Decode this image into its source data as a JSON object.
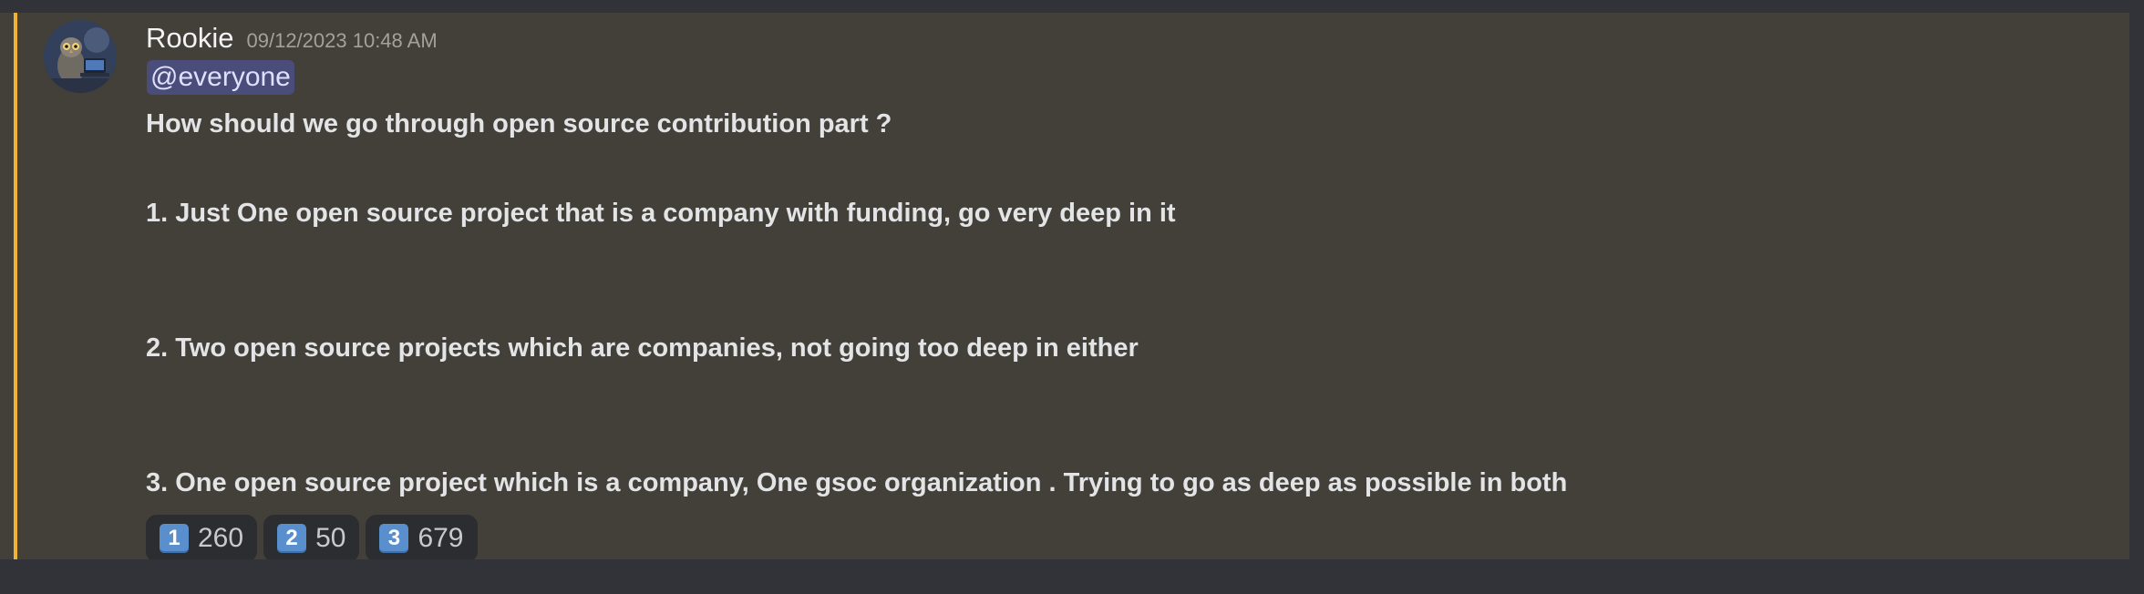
{
  "message": {
    "author": "Rookie",
    "timestamp": "09/12/2023 10:48 AM",
    "mention": "@everyone",
    "lines": [
      "How should we go through open source contribution part ?",
      "1. Just One open source project that is a company with funding, go very deep in it",
      "2. Two open source projects which are companies, not going too deep in either",
      "3. One open source project which is a company, One gsoc organization . Trying to go as deep as possible in both"
    ],
    "reactions": [
      {
        "emoji": "1",
        "icon": "keycap-1-icon",
        "count": "260"
      },
      {
        "emoji": "2",
        "icon": "keycap-2-icon",
        "count": "50"
      },
      {
        "emoji": "3",
        "icon": "keycap-3-icon",
        "count": "679"
      }
    ]
  },
  "colors": {
    "background": "#313338",
    "message_highlight": "#433f39",
    "mention_bar": "#f0b232",
    "keycap": "#5a8fcd"
  }
}
